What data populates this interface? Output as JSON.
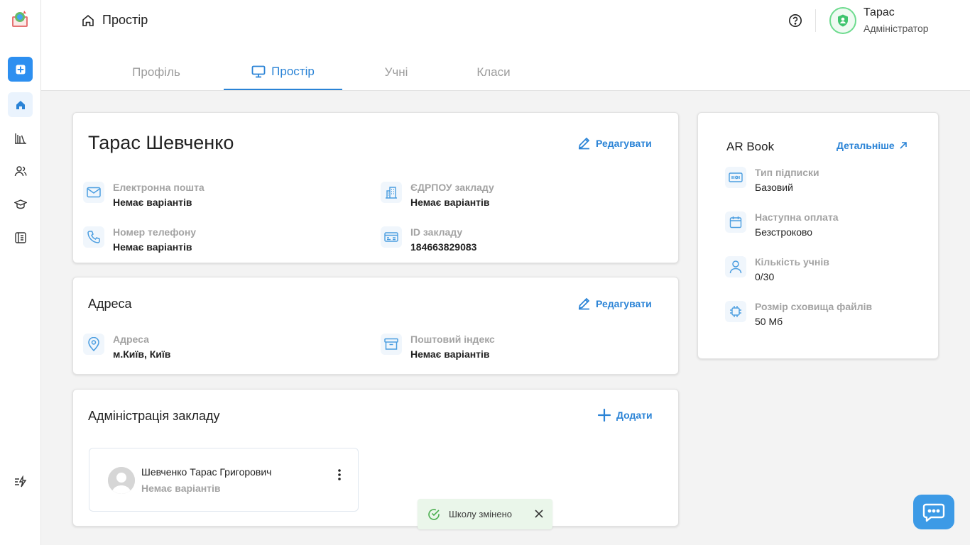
{
  "header": {
    "breadcrumb": "Простір",
    "user": {
      "name": "Тарас",
      "role": "Адміністратор"
    }
  },
  "tabs": [
    {
      "label": "Профіль"
    },
    {
      "label": "Простір"
    },
    {
      "label": "Учні"
    },
    {
      "label": "Класи"
    }
  ],
  "profile": {
    "name": "Тарас Шевченко",
    "edit_label": "Редагувати",
    "fields": [
      {
        "label": "Електронна пошта",
        "value": "Немає варіантів"
      },
      {
        "label": "ЄДРПОУ закладу",
        "value": "Немає варіантів"
      },
      {
        "label": "Номер телефону",
        "value": "Немає варіантів"
      },
      {
        "label": "ID закладу",
        "value": "184663829083"
      }
    ]
  },
  "address": {
    "title": "Адреса",
    "edit_label": "Редагувати",
    "fields": [
      {
        "label": "Адреса",
        "value": "м.Київ, Київ"
      },
      {
        "label": "Поштовий індекс",
        "value": "Немає варіантів"
      }
    ]
  },
  "administration": {
    "title": "Адміністрація закладу",
    "add_label": "Додати",
    "items": [
      {
        "name": "Шевченко Тарас Григорович",
        "sub": "Немає варіантів"
      }
    ]
  },
  "subscription": {
    "title": "AR Book",
    "details_label": "Детальніше",
    "fields": [
      {
        "label": "Тип підписки",
        "value": "Базовий"
      },
      {
        "label": "Наступна оплата",
        "value": "Безстроково"
      },
      {
        "label": "Кількість учнів",
        "value": "0/30"
      },
      {
        "label": "Розмір сховища файлів",
        "value": "50 Мб"
      }
    ]
  },
  "toast": {
    "message": "Школу змінено"
  },
  "colors": {
    "accent": "#2a83d6",
    "sidebar_add": "#2d8ff0",
    "chat": "#3c9ae6",
    "toast_bg": "#eaf6ea",
    "avatar_ring": "#6ddb8e"
  }
}
